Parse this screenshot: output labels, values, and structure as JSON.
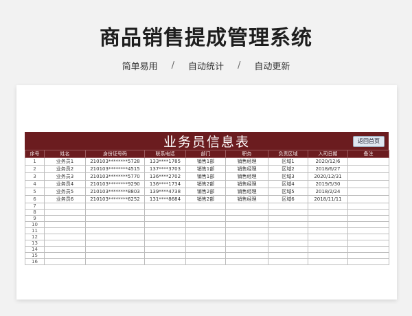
{
  "header": {
    "title": "商品销售提成管理系统",
    "tags": [
      "简单易用",
      "自动统计",
      "自动更新"
    ],
    "separator": "/"
  },
  "sheet": {
    "banner_title": "业务员信息表",
    "back_button": "返回首页",
    "columns": [
      "序号",
      "姓名",
      "身份证号码",
      "联系电话",
      "部门",
      "职务",
      "负责区域",
      "入司日期",
      "备注"
    ],
    "rows": [
      [
        "1",
        "业务员1",
        "210103********5728",
        "133****1785",
        "销售1部",
        "销售经理",
        "区域1",
        "2020/12/6",
        ""
      ],
      [
        "2",
        "业务员2",
        "210103********4515",
        "137****3703",
        "销售1部",
        "销售经理",
        "区域2",
        "2018/6/27",
        ""
      ],
      [
        "3",
        "业务员3",
        "210103********5770",
        "136****2702",
        "销售1部",
        "销售经理",
        "区域3",
        "2020/12/31",
        ""
      ],
      [
        "4",
        "业务员4",
        "210103********9290",
        "136****1734",
        "销售2部",
        "销售经理",
        "区域4",
        "2019/5/30",
        ""
      ],
      [
        "5",
        "业务员5",
        "210103********8803",
        "139****4738",
        "销售2部",
        "销售经理",
        "区域5",
        "2018/2/24",
        ""
      ],
      [
        "6",
        "业务员6",
        "210103********6252",
        "131****8684",
        "销售2部",
        "销售经理",
        "区域6",
        "2018/11/11",
        ""
      ],
      [
        "7",
        "",
        "",
        "",
        "",
        "",
        "",
        "",
        ""
      ],
      [
        "8",
        "",
        "",
        "",
        "",
        "",
        "",
        "",
        ""
      ],
      [
        "9",
        "",
        "",
        "",
        "",
        "",
        "",
        "",
        ""
      ],
      [
        "10",
        "",
        "",
        "",
        "",
        "",
        "",
        "",
        ""
      ],
      [
        "11",
        "",
        "",
        "",
        "",
        "",
        "",
        "",
        ""
      ],
      [
        "12",
        "",
        "",
        "",
        "",
        "",
        "",
        "",
        ""
      ],
      [
        "13",
        "",
        "",
        "",
        "",
        "",
        "",
        "",
        ""
      ],
      [
        "14",
        "",
        "",
        "",
        "",
        "",
        "",
        "",
        ""
      ],
      [
        "15",
        "",
        "",
        "",
        "",
        "",
        "",
        "",
        ""
      ],
      [
        "16",
        "",
        "",
        "",
        "",
        "",
        "",
        "",
        ""
      ]
    ]
  },
  "colors": {
    "banner": "#6b1c1f",
    "page_background": "#f2f2f2"
  }
}
